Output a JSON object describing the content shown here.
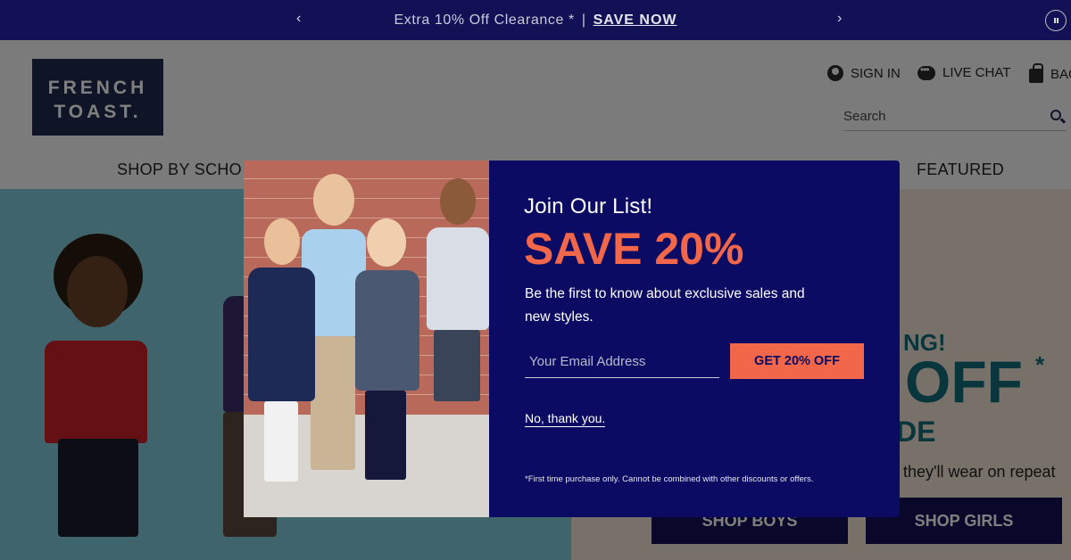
{
  "promo_bar": {
    "prev_arrow": "‹",
    "next_arrow": "›",
    "message": "Extra 10% Off Clearance *",
    "separator": "|",
    "cta": "SAVE NOW"
  },
  "header": {
    "logo_line1": "FRENCH",
    "logo_line2": "TOAST.",
    "sign_in": "SIGN IN",
    "live_chat": "LIVE CHAT",
    "bag": "BAG",
    "search_placeholder": "Search",
    "nav": {
      "shop_by_school": "SHOP BY SCHO",
      "featured": "FEATURED"
    }
  },
  "hero": {
    "headline_top": "NG!",
    "headline_main": "OFF",
    "headline_star": "*",
    "headline_bottom": "DE",
    "subtext": "s they'll wear on repeat",
    "shop_boys": "SHOP BOYS",
    "shop_girls": "SHOP GIRLS",
    "colors": {
      "left_bg": "#7ec8d8",
      "right_bg": "#f1e3d2",
      "accent": "#126b78",
      "button": "#131156"
    }
  },
  "modal": {
    "title": "Join Our List!",
    "headline": "SAVE 20%",
    "description": "Be the first to know about exclusive sales and new styles.",
    "email_placeholder": "Your Email Address",
    "submit_label": "GET 20% OFF",
    "decline_label": "No, thank you.",
    "fine_print": "*First time purchase only. Cannot be combined with other discounts or offers.",
    "colors": {
      "background": "#0b0b63",
      "accent": "#f2664a"
    }
  }
}
